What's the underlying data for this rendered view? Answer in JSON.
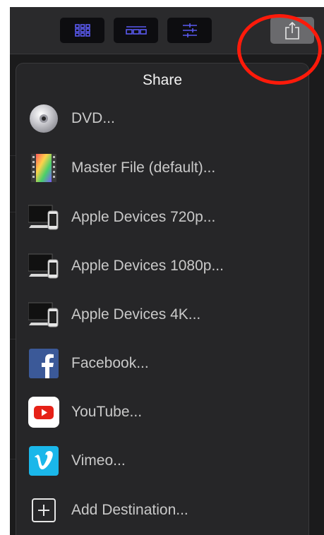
{
  "toolbar": {
    "buttons": [
      {
        "name": "browser-grid-icon"
      },
      {
        "name": "timeline-icon"
      },
      {
        "name": "inspector-sliders-icon"
      }
    ],
    "share_icon": "share-icon",
    "accent_color": "#5a5af0",
    "highlight_color": "#ff1a0a"
  },
  "share_menu": {
    "title": "Share",
    "items": [
      {
        "label": "DVD...",
        "icon": "dvd-icon"
      },
      {
        "label": "Master File (default)...",
        "icon": "master-file-icon"
      },
      {
        "label": "Apple Devices 720p...",
        "icon": "apple-devices-icon"
      },
      {
        "label": "Apple Devices 1080p...",
        "icon": "apple-devices-icon"
      },
      {
        "label": "Apple Devices 4K...",
        "icon": "apple-devices-icon"
      },
      {
        "label": "Facebook...",
        "icon": "facebook-icon"
      },
      {
        "label": "YouTube...",
        "icon": "youtube-icon"
      },
      {
        "label": "Vimeo...",
        "icon": "vimeo-icon"
      },
      {
        "label": "Add Destination...",
        "icon": "add-destination-icon"
      }
    ]
  }
}
